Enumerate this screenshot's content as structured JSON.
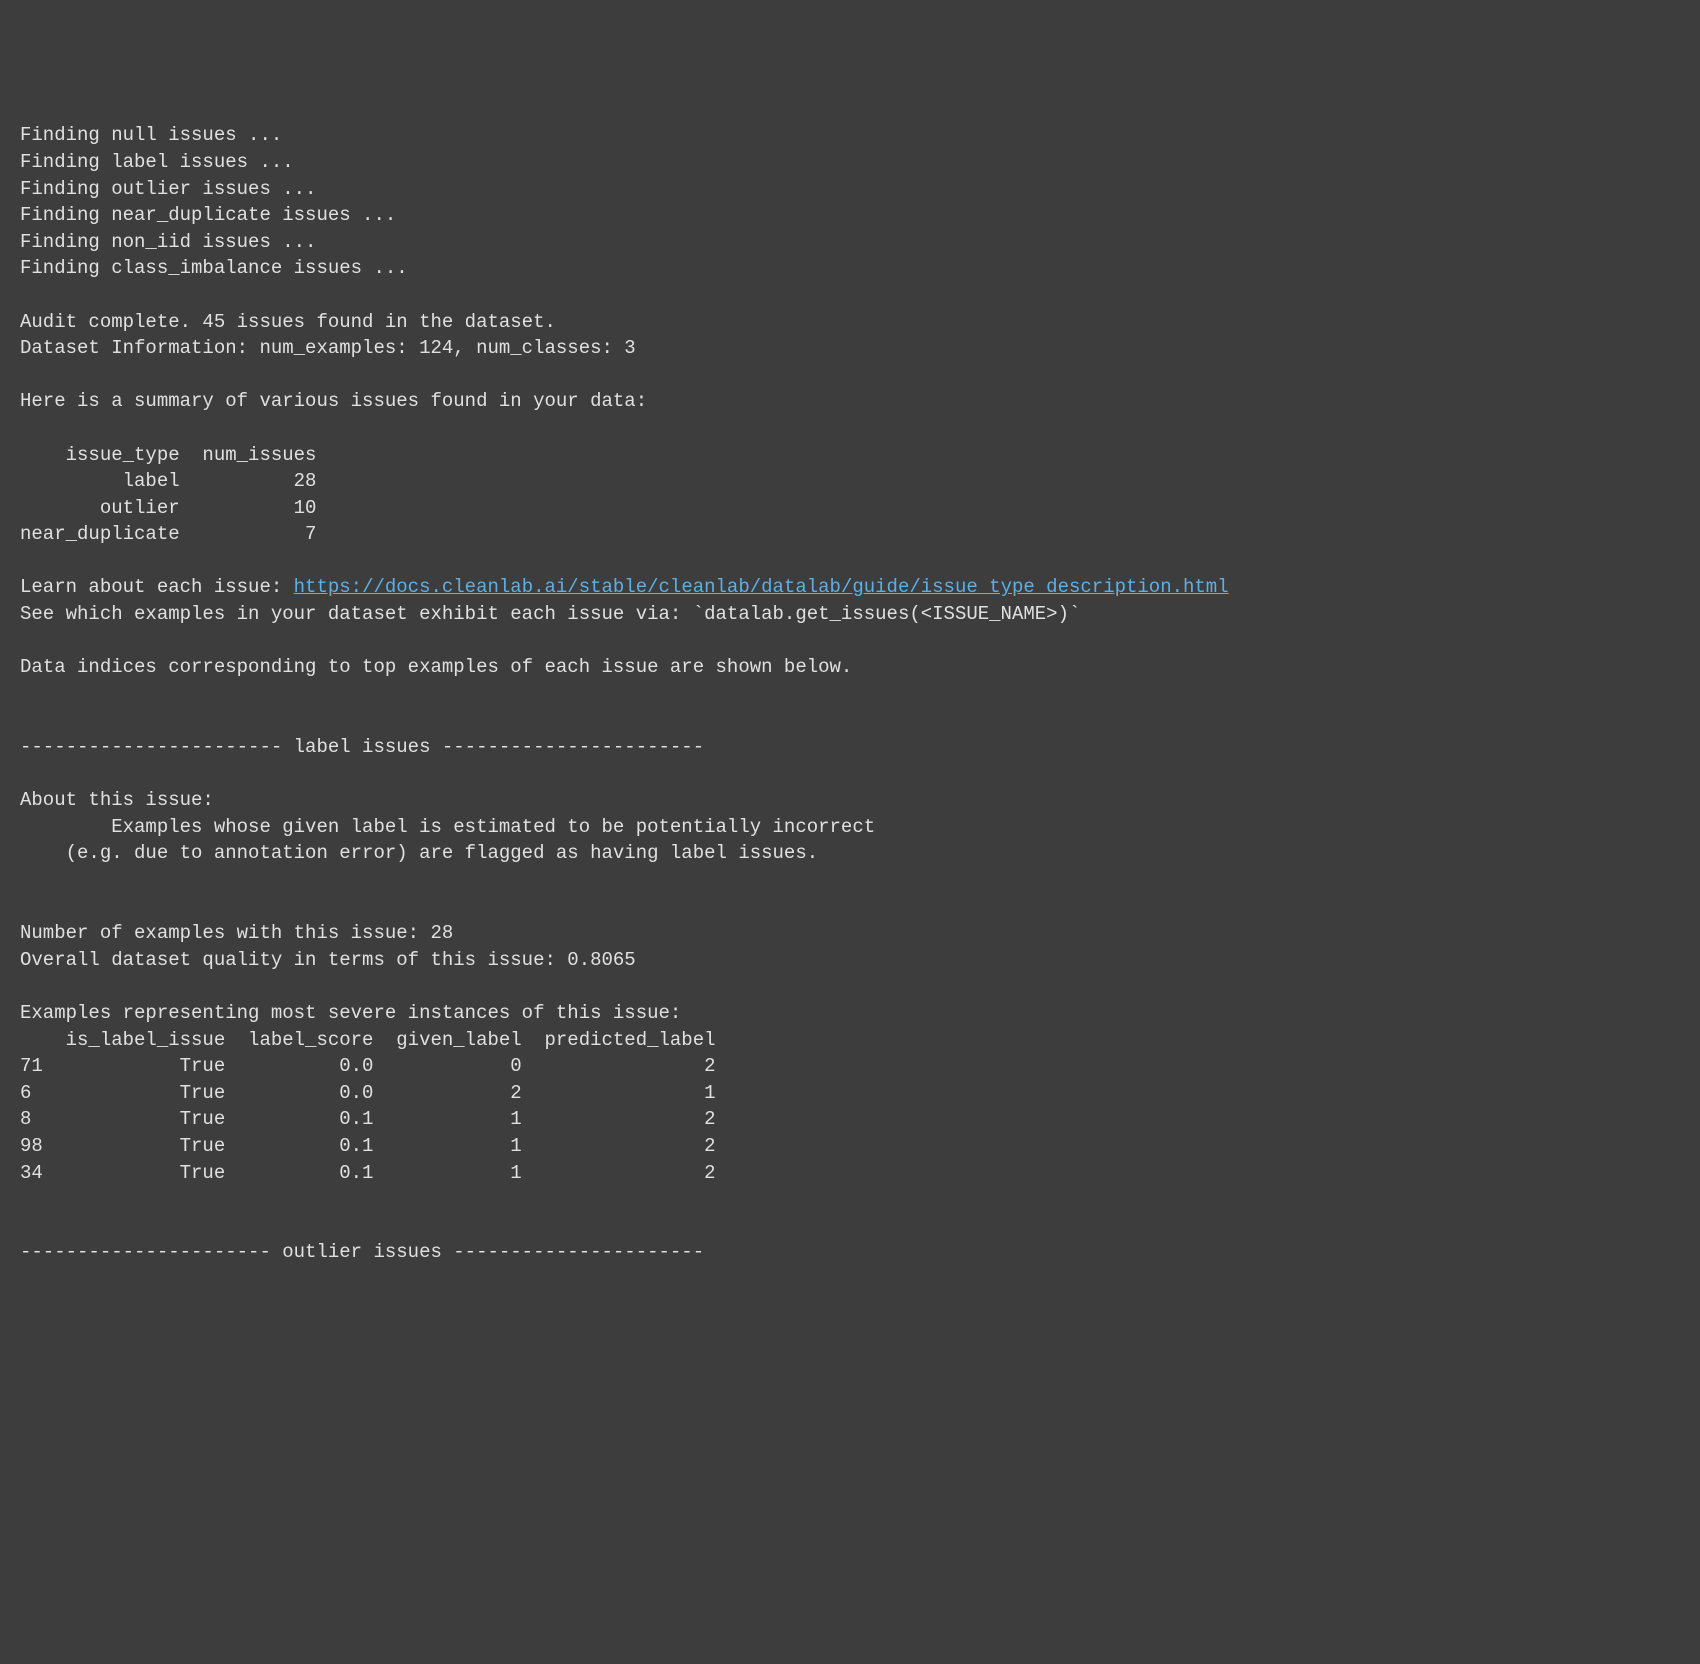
{
  "finding_lines": [
    "Finding null issues ...",
    "Finding label issues ...",
    "Finding outlier issues ...",
    "Finding near_duplicate issues ...",
    "Finding non_iid issues ...",
    "Finding class_imbalance issues ..."
  ],
  "audit_complete": "Audit complete. 45 issues found in the dataset.",
  "dataset_info": "Dataset Information: num_examples: 124, num_classes: 3",
  "summary_intro": "Here is a summary of various issues found in your data:",
  "summary_header": "    issue_type  num_issues",
  "summary_rows": [
    "         label          28",
    "       outlier          10",
    "near_duplicate           7"
  ],
  "learn_prefix": "Learn about each issue: ",
  "learn_url": "https://docs.cleanlab.ai/stable/cleanlab/datalab/guide/issue_type_description.html",
  "see_which": "See which examples in your dataset exhibit each issue via: `datalab.get_issues(<ISSUE_NAME>)`",
  "indices_intro": "Data indices corresponding to top examples of each issue are shown below.",
  "label_section_header": "----------------------- label issues -----------------------",
  "about_this_issue": "About this issue:",
  "label_about_1": "        Examples whose given label is estimated to be potentially incorrect",
  "label_about_2": "    (e.g. due to annotation error) are flagged as having label issues.",
  "label_count": "Number of examples with this issue: 28",
  "label_quality": "Overall dataset quality in terms of this issue: 0.8065",
  "label_examples_intro": "Examples representing most severe instances of this issue:",
  "label_table_header": "    is_label_issue  label_score  given_label  predicted_label",
  "label_table_rows": [
    "71            True          0.0            0                2",
    "6             True          0.0            2                1",
    "8             True          0.1            1                2",
    "98            True          0.1            1                2",
    "34            True          0.1            1                2"
  ],
  "outlier_section_header": "---------------------- outlier issues ----------------------"
}
